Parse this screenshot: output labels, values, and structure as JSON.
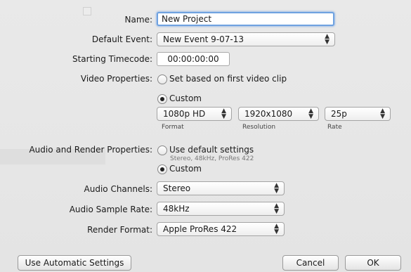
{
  "labels": {
    "name": "Name:",
    "default_event": "Default Event:",
    "starting_timecode": "Starting Timecode:",
    "video_properties": "Video Properties:",
    "audio_render_properties": "Audio and Render Properties:",
    "audio_channels": "Audio Channels:",
    "audio_sample_rate": "Audio Sample Rate:",
    "render_format": "Render Format:"
  },
  "fields": {
    "name_value": "New Project",
    "default_event_value": "New Event 9-07-13",
    "timecode_value": "00:00:00:00"
  },
  "video": {
    "option_first_clip": "Set based on first video clip",
    "option_custom": "Custom",
    "selected": "Custom",
    "format": {
      "value": "1080p HD",
      "caption": "Format"
    },
    "resolution": {
      "value": "1920x1080",
      "caption": "Resolution"
    },
    "rate": {
      "value": "25p",
      "caption": "Rate"
    }
  },
  "audio_render": {
    "option_default": "Use default settings",
    "default_hint": "Stereo, 48kHz, ProRes 422",
    "option_custom": "Custom",
    "selected": "Custom"
  },
  "popups": {
    "audio_channels": "Stereo",
    "audio_sample_rate": "48kHz",
    "render_format": "Apple ProRes 422"
  },
  "buttons": {
    "use_automatic": "Use Automatic Settings",
    "cancel": "Cancel",
    "ok": "OK"
  }
}
